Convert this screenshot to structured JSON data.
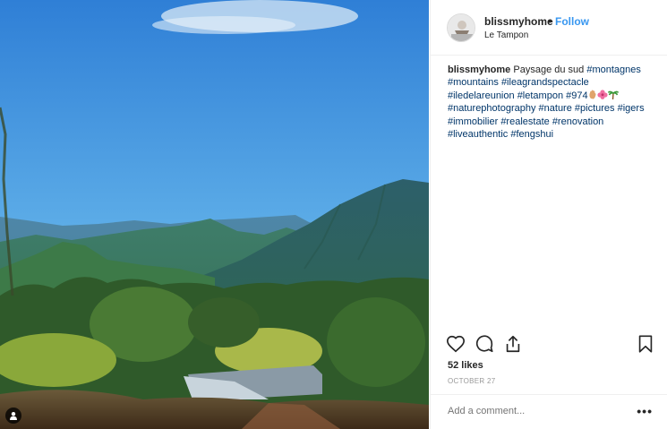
{
  "post": {
    "username": "blissmyhome",
    "separator": "•",
    "follow_label": "Follow",
    "location": "Le Tampon",
    "caption": {
      "username": "blissmyhome",
      "text_before": "Paysage du sud",
      "hashtags_line1": [
        "#montagnes"
      ],
      "hashtags": [
        "#mountains",
        "#ileagrandspectacle",
        "#iledelareunion",
        "#letampon",
        "#974"
      ],
      "emojis": [
        "hand-emoji",
        "hibiscus-emoji",
        "palm-tree-emoji"
      ],
      "hashtags_after": [
        "#naturephotography",
        "#nature",
        "#pictures",
        "#igers",
        "#immobilier",
        "#realestate",
        "#renovation",
        "#liveauthentic",
        "#fengshui"
      ]
    },
    "likes_label": "52 likes",
    "date": "OCTOBER 27",
    "comment_placeholder": "Add a comment...",
    "more_label": "•••"
  },
  "icons": {
    "like": "heart-icon",
    "comment": "comment-icon",
    "share": "share-icon",
    "save": "bookmark-icon",
    "tag": "user-tag-icon"
  },
  "colors": {
    "follow": "#3897f0",
    "hashtag": "#003569",
    "muted": "#999999",
    "text": "#262626"
  }
}
